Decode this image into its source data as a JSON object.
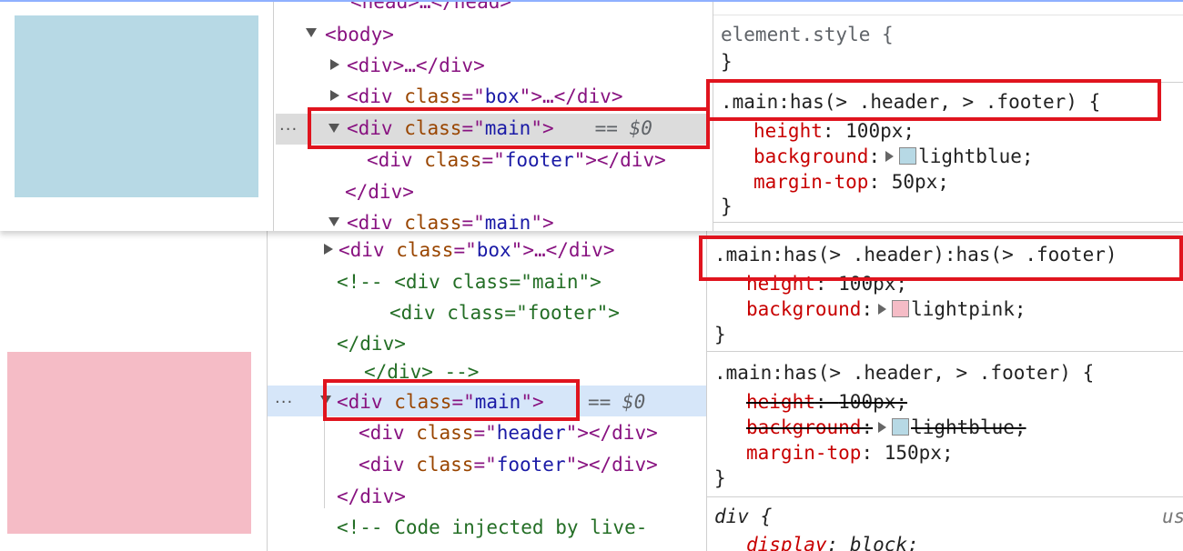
{
  "colors": {
    "preview_top": "#b7d9e5",
    "preview_bottom": "#f5bcc6",
    "highlight_top": "#dcdcdc",
    "highlight_bottom": "#d6e6f9"
  },
  "top": {
    "dom": {
      "head_line": "<head>…</head>",
      "body_line": "<body>",
      "div1": {
        "open": "<div>",
        "rest": "…</div>"
      },
      "div2": {
        "open": "<div ",
        "attr": "class",
        "eq": "=\"",
        "val": "box",
        "close": "\">…</div>"
      },
      "div3": {
        "open": "<div ",
        "attr": "class",
        "eq": "=\"",
        "val": "main",
        "close": "\">",
        "marker": " == $0"
      },
      "footer": {
        "open": "<div ",
        "attr": "class",
        "eq": "=\"",
        "val": "footer",
        "close": "\"></div>"
      },
      "close_div": "</div>",
      "div4": {
        "open": "<div ",
        "attr": "class",
        "eq": "=\"",
        "val": "main",
        "close": "\">"
      }
    },
    "styles": {
      "element_style": "element.style {",
      "element_style_close": "}",
      "rule_selector": ".main:has(> .header, > .footer) {",
      "props": [
        {
          "name": "height",
          "value": "100px;"
        },
        {
          "name": "background",
          "value": "lightblue;"
        },
        {
          "name": "margin-top",
          "value": "50px;"
        }
      ],
      "rule_close": "}"
    }
  },
  "bottom": {
    "dom": {
      "box_line": {
        "open": "<div ",
        "attr": "class",
        "eq": "=\"",
        "val": "box",
        "close": "\">…</div>"
      },
      "comment1": "<!-- <div class=\"main\">",
      "comment2": "<div class=\"footer\">",
      "comment3": "</div>",
      "comment4": "</div> -->",
      "main_line": {
        "open": "<div ",
        "attr": "class",
        "eq": "=\"",
        "val": "main",
        "close": "\">",
        "marker": "== $0"
      },
      "header": {
        "open": "<div ",
        "attr": "class",
        "eq": "=\"",
        "val": "header",
        "close": "\"></div>"
      },
      "footer": {
        "open": "<div ",
        "attr": "class",
        "eq": "=\"",
        "val": "footer",
        "close": "\"></div>"
      },
      "close_div": "</div>",
      "comment5": "<!-- Code injected by live-"
    },
    "styles": {
      "rule1_selector": ".main:has(> .header):has(> .footer)",
      "rule1_props": [
        {
          "name": "height",
          "value": "100px;"
        },
        {
          "name": "background",
          "value": "lightpink;"
        }
      ],
      "rule1_close": "}",
      "rule2_selector": ".main:has(> .header, > .footer) {",
      "rule2_props": [
        {
          "name": "height",
          "value": "100px;"
        },
        {
          "name": "background",
          "value": "lightblue;"
        },
        {
          "name": "margin-top",
          "value": "150px;"
        }
      ],
      "rule2_close": "}",
      "div_rule_selector": "div {",
      "div_rule_source": "us",
      "div_rule_prop": {
        "name": "display",
        "value": "block;"
      }
    }
  },
  "dots_label": "···"
}
